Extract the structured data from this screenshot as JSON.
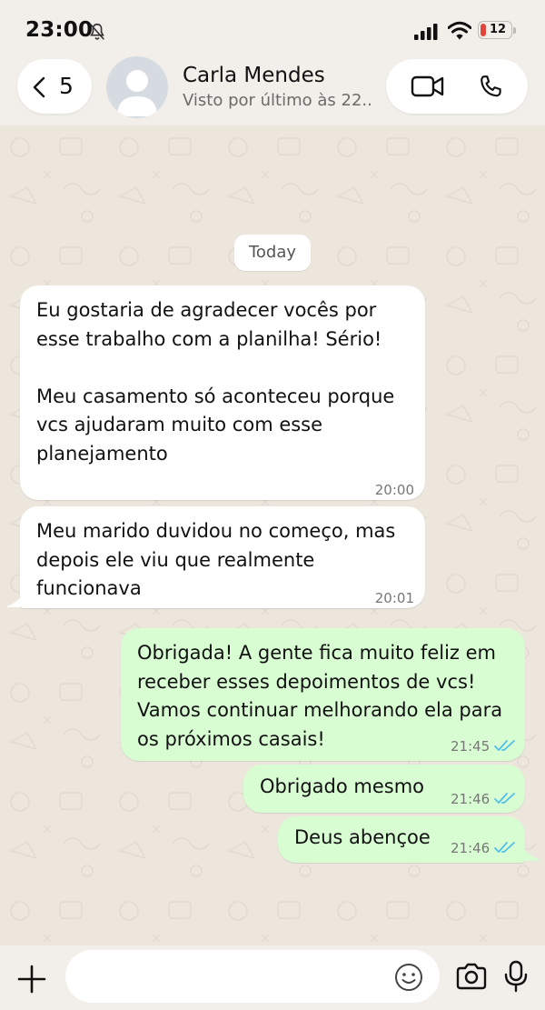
{
  "status_bar": {
    "time": "23:00",
    "battery": "12"
  },
  "header": {
    "back_count": "5",
    "contact_name": "Carla Mendes",
    "last_seen": "Visto por último às 22..."
  },
  "chat": {
    "date_label": "Today",
    "messages": [
      {
        "direction": "incoming",
        "text": "Eu gostaria de agradecer vocês por\nesse trabalho com a planilha! Sério!\n\nMeu casamento só aconteceu porque\nvcs ajudaram muito com esse\nplanejamento",
        "time": "20:00"
      },
      {
        "direction": "incoming",
        "text": "Meu marido duvidou no começo, mas\ndepois ele viu que realmente\nfuncionava",
        "time": "20:01"
      },
      {
        "direction": "outgoing",
        "text": "Obrigada! A gente fica muito feliz em\nreceber esses depoimentos de vcs!\nVamos continuar melhorando ela para\nos próximos casais!",
        "time": "21:45",
        "status": "read"
      },
      {
        "direction": "outgoing",
        "text": "Obrigado mesmo",
        "time": "21:46",
        "status": "read"
      },
      {
        "direction": "outgoing",
        "text": "Deus abençoe",
        "time": "21:46",
        "status": "read"
      }
    ]
  },
  "input": {
    "placeholder": "",
    "value": ""
  },
  "icons": {
    "status": [
      "bell-off-icon",
      "signal-icon",
      "wifi-icon",
      "battery-icon"
    ],
    "header": [
      "chevron-left-icon",
      "avatar-placeholder-icon",
      "video-call-icon",
      "phone-call-icon"
    ],
    "input": [
      "plus-icon",
      "emoji-icon",
      "camera-icon",
      "microphone-icon"
    ],
    "message_status": "double-check-icon"
  },
  "colors": {
    "incoming_bubble": "#ffffff",
    "outgoing_bubble": "#d9fdd3",
    "read_ticks": "#53bdeb",
    "chat_background": "#ece6dd",
    "bar_background": "#f2eee9"
  }
}
